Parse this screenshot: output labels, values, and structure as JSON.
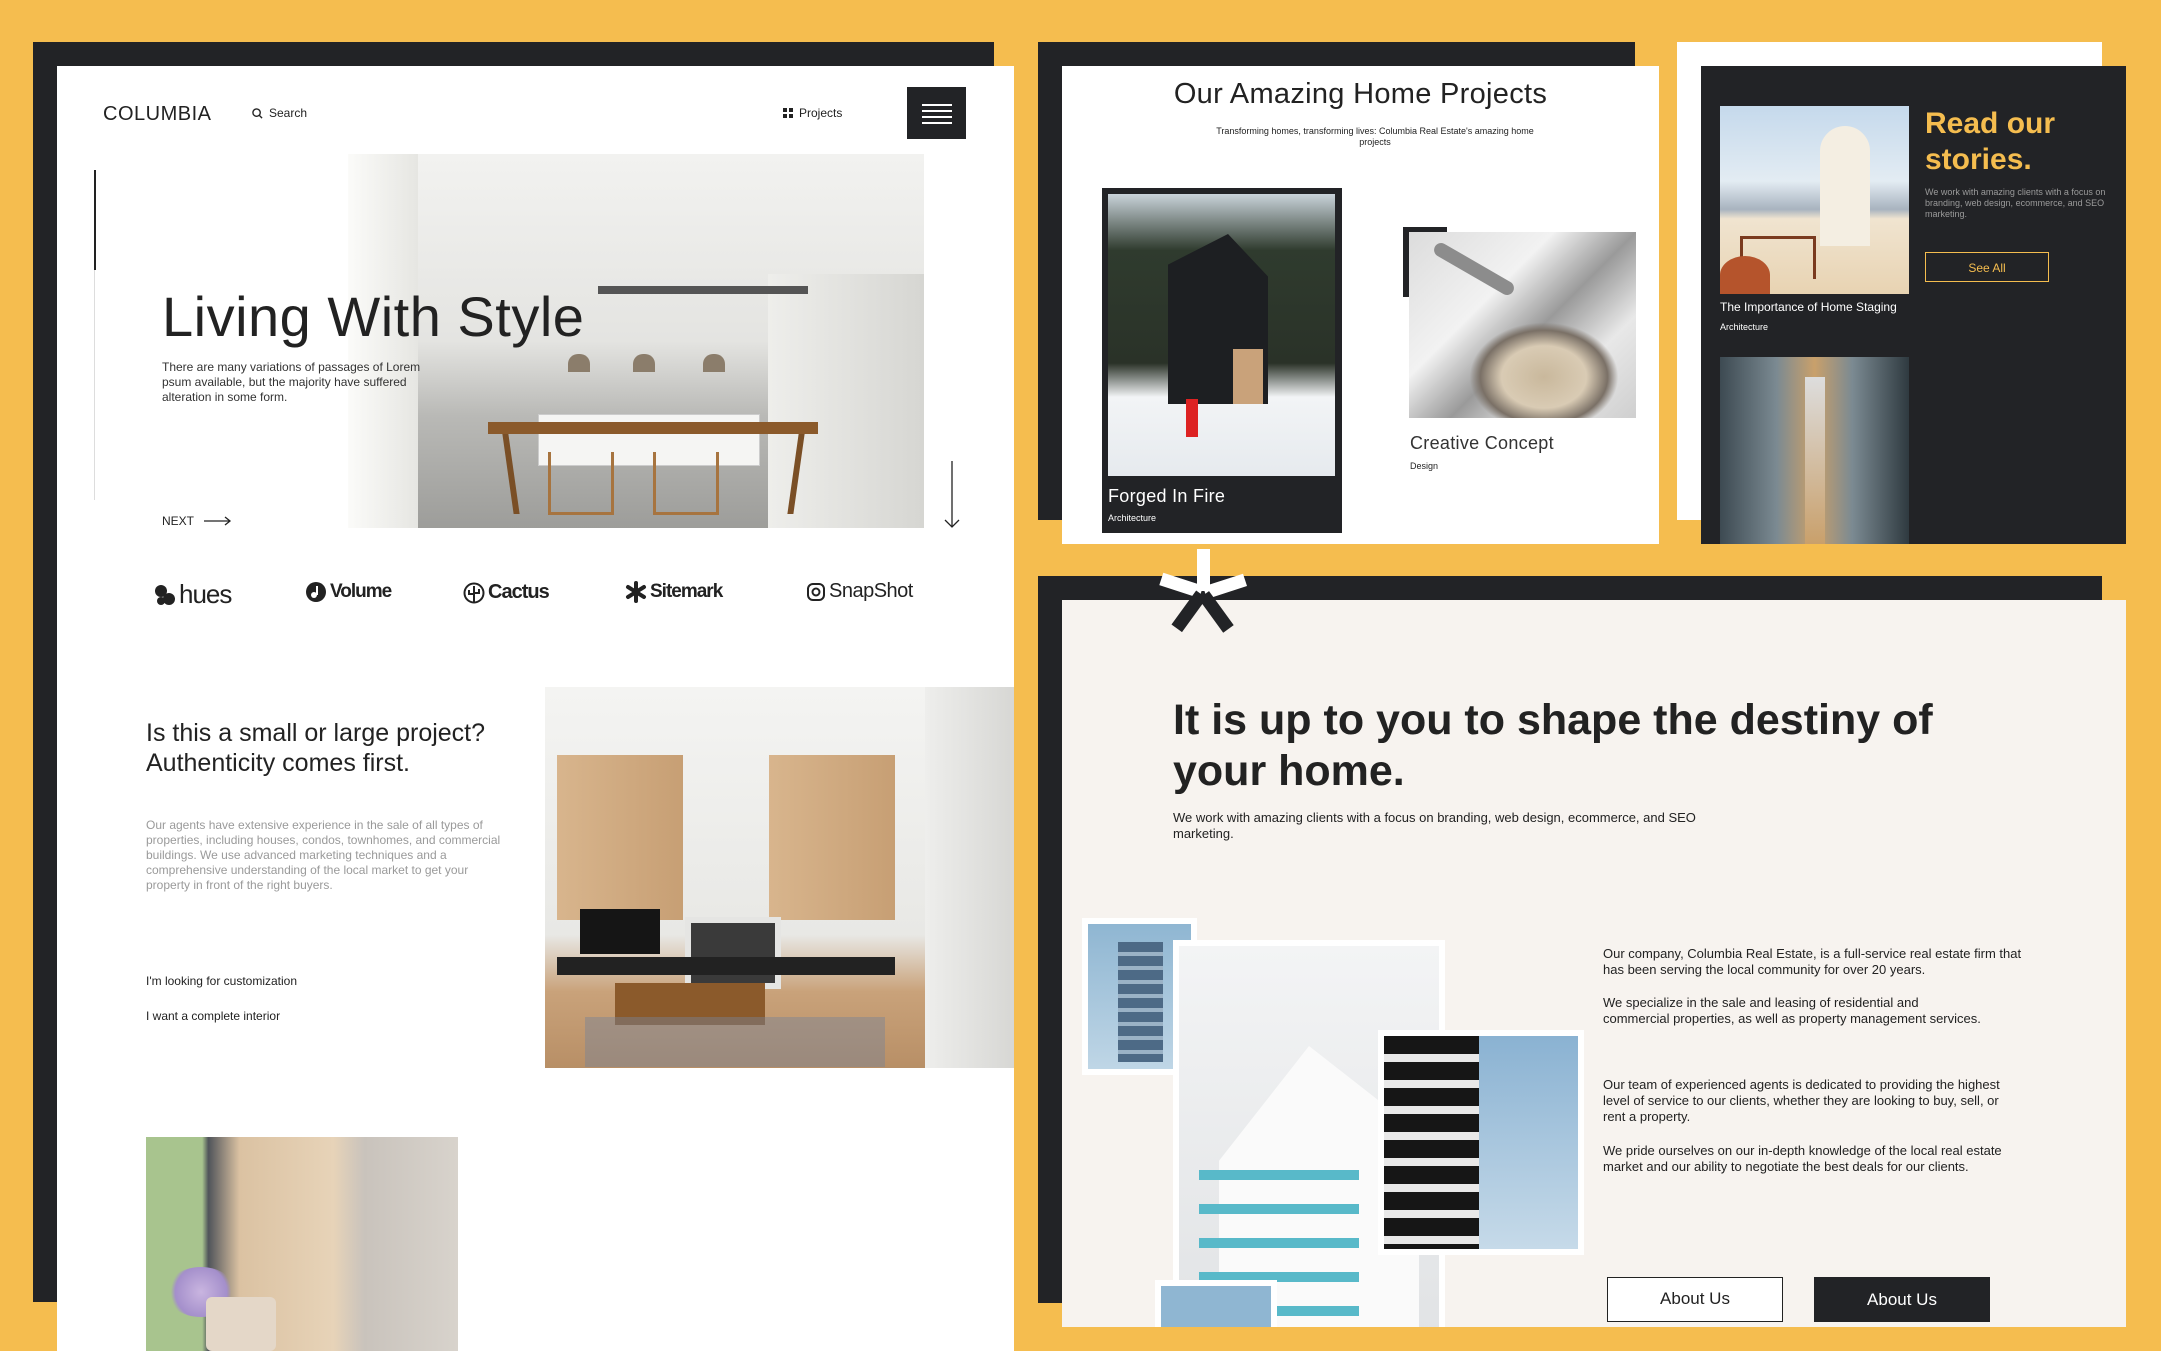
{
  "home": {
    "logo": "COLUMBIA",
    "search_label": "Search",
    "projects_label": "Projects",
    "hero": {
      "title": "Living With Style",
      "text": "There are many variations of passages of Lorem psum available, but the majority have suffered alteration in some form.",
      "next_label": "NEXT"
    },
    "brands": [
      "hues",
      "Volume",
      "Cactus",
      "Sitemark",
      "SnapShot"
    ],
    "project_section": {
      "heading": "Is this a small or large project? Authenticity comes first.",
      "body": "Our agents have extensive experience in the sale of all types of properties, including houses, condos, townhomes, and commercial buildings. We use advanced marketing techniques and a comprehensive understanding of the local market to get your property in front of the right buyers.",
      "link1": "I'm looking for customization",
      "link2": "I want a complete interior"
    }
  },
  "projects_page": {
    "title": "Our Amazing Home Projects",
    "subtitle": "Transforming homes, transforming lives: Columbia Real Estate's amazing home projects",
    "card1": {
      "title": "Forged In Fire",
      "tag": "Architecture"
    },
    "card2": {
      "title": "Creative Concept",
      "tag": "Design"
    }
  },
  "stories": {
    "heading": "Read our stories.",
    "text": "We work with amazing clients with a focus on branding, web design, ecommerce, and SEO marketing.",
    "see_all": "See All",
    "card_title": "The Importance of Home Staging",
    "card_tag": "Architecture"
  },
  "about": {
    "heading": "It is up to you to shape the destiny of your home.",
    "sub": "We work with amazing clients with a focus on branding, web design, ecommerce, and SEO marketing.",
    "p1": "Our company, Columbia Real Estate, is a full-service real estate firm that has been serving the local community for over 20 years.",
    "p2": "We specialize in the sale and leasing of residential and commercial properties, as well as property management services.",
    "p3": "Our team of experienced agents is dedicated to providing the highest level of service to our clients, whether they are looking to buy, sell, or rent a property.",
    "p4": "We pride ourselves on our in-depth knowledge of the local real estate market and our ability to negotiate the best deals for our clients.",
    "btn_outline": "About Us",
    "btn_dark": "About Us"
  },
  "colors": {
    "accent": "#f5bd4f",
    "dark": "#222326",
    "cream": "#f7f3ef"
  }
}
